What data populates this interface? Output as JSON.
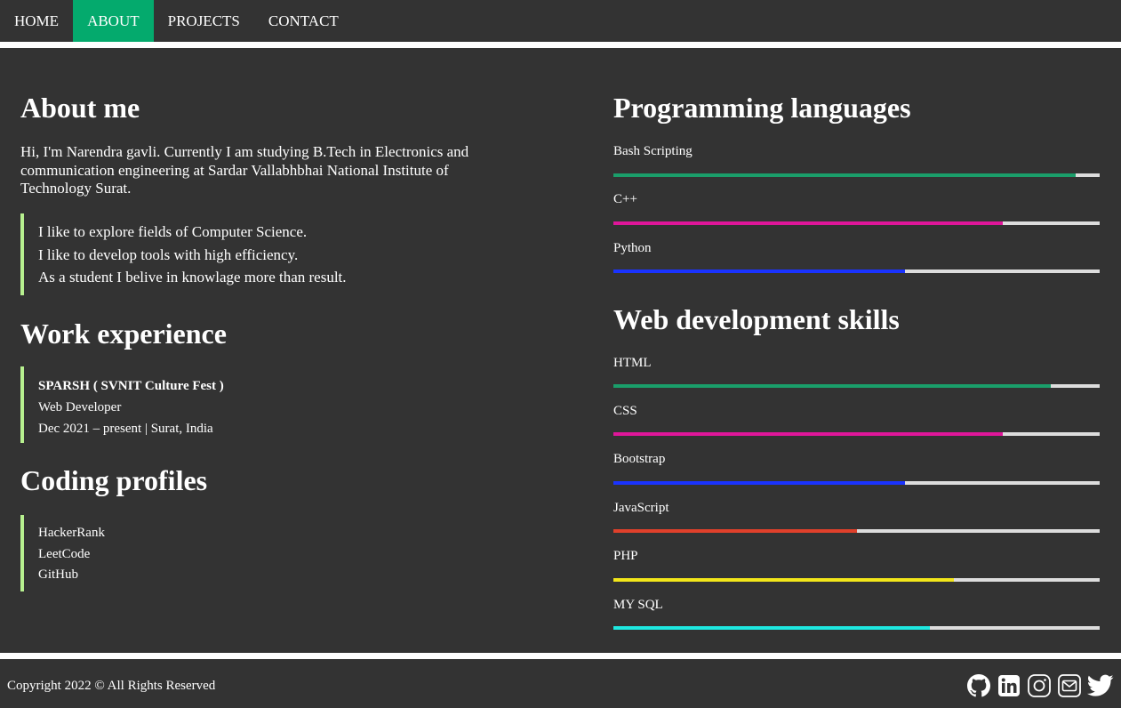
{
  "nav": {
    "items": [
      {
        "label": "HOME",
        "active": false
      },
      {
        "label": "ABOUT",
        "active": true
      },
      {
        "label": "PROJECTS",
        "active": false
      },
      {
        "label": "CONTACT",
        "active": false
      }
    ]
  },
  "about": {
    "title": "About me",
    "intro": "Hi, I'm Narendra gavli. Currently I am studying B.Tech in Electronics and communication engineering at Sardar Vallabhbhai National Institute of Technology Surat.",
    "quotes": [
      "I like to explore fields of Computer Science.",
      "I like to develop tools with high efficiency.",
      "As a student I belive in knowlage more than result."
    ]
  },
  "work": {
    "title": "Work experience",
    "company": "SPARSH ( SVNIT Culture Fest )",
    "role": "Web Developer",
    "period": "Dec 2021 – present | Surat, India"
  },
  "profiles": {
    "title": "Coding profiles",
    "items": [
      "HackerRank",
      "LeetCode",
      "GitHub"
    ]
  },
  "programming": {
    "title": "Programming languages",
    "skills": [
      {
        "name": "Bash Scripting",
        "level": 0.95,
        "color": "#1a9e6a"
      },
      {
        "name": "C++",
        "level": 0.8,
        "color": "#e0169a"
      },
      {
        "name": "Python",
        "level": 0.6,
        "color": "#1a33ff"
      }
    ]
  },
  "webdev": {
    "title": "Web development skills",
    "skills": [
      {
        "name": "HTML",
        "level": 0.9,
        "color": "#1a9e6a"
      },
      {
        "name": "CSS",
        "level": 0.8,
        "color": "#e0169a"
      },
      {
        "name": "Bootstrap",
        "level": 0.6,
        "color": "#1a33ff"
      },
      {
        "name": "JavaScript",
        "level": 0.5,
        "color": "#e0402b"
      },
      {
        "name": "PHP",
        "level": 0.7,
        "color": "#f2e61a"
      },
      {
        "name": "MY SQL",
        "level": 0.65,
        "color": "#1ee8e0"
      }
    ]
  },
  "footer": {
    "copyright": "Copyright 2022 © All Rights Reserved",
    "social": [
      "github-icon",
      "linkedin-icon",
      "instagram-icon",
      "mail-icon",
      "twitter-icon"
    ]
  },
  "colors": {
    "accent": "#04AA6D",
    "border": "#b7f08f",
    "background": "#333333"
  }
}
